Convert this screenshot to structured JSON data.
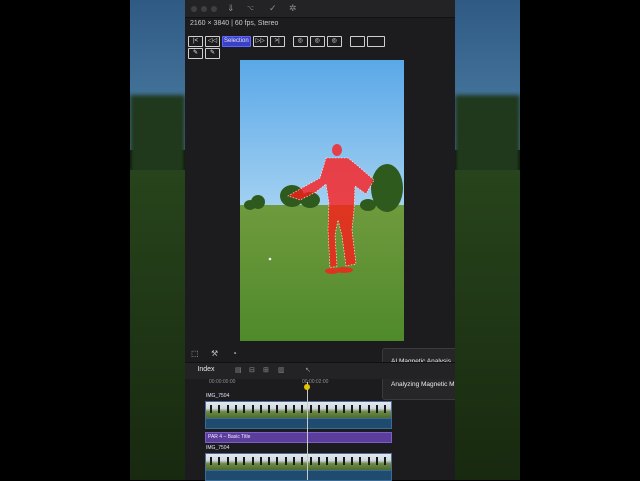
{
  "format_info": "2160 × 3840 | 60 fps, Stereo",
  "toolbar": {
    "row1": [
      "|<",
      "◁◁",
      "Selection",
      "▷▷",
      ">|",
      "◎",
      "◎",
      "◎",
      "",
      ""
    ],
    "row2": [
      "✎",
      "✎"
    ]
  },
  "status_popup": {
    "title": "AI Magnetic Analysis",
    "progress": 1.0,
    "subtitle": "Analyzing Magnetic M"
  },
  "timeline": {
    "index_tab": "Index",
    "ruler_start": "00:00:00:00",
    "ruler_mid": "00:00:02:00",
    "clip1_name": "IMG_7504",
    "title_clip_name": "PAR 4 – Basic Title",
    "clip2_name": "IMG_7504"
  },
  "colors": {
    "mask": "#ff1a1a",
    "accent": "#3a40c8",
    "title_clip": "#5b3e9b"
  }
}
